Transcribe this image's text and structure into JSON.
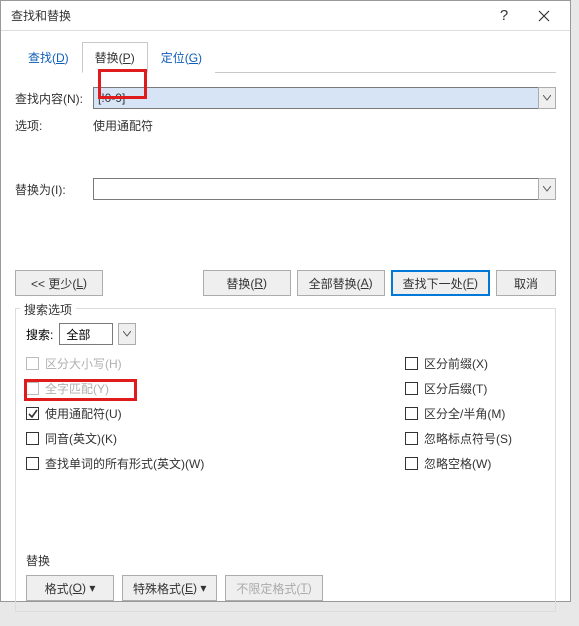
{
  "titlebar": {
    "title": "查找和替换"
  },
  "tabs": {
    "find": {
      "label": "查找(",
      "key": "D",
      "suffix": ")"
    },
    "replace": {
      "label": "替换(",
      "key": "P",
      "suffix": ")"
    },
    "goto": {
      "label": "定位(",
      "key": "G",
      "suffix": ")"
    }
  },
  "form": {
    "find_label_pre": "查找内容(",
    "find_key": "N",
    "find_label_suf": "):",
    "find_value": "[!0-9]",
    "options_label": "选项:",
    "options_value": "使用通配符",
    "replace_label_pre": "替换为(",
    "replace_key": "I",
    "replace_label_suf": "):",
    "replace_value": ""
  },
  "buttons": {
    "less_pre": "<< 更少(",
    "less_key": "L",
    "less_suf": ")",
    "replace_pre": "替换(",
    "replace_key": "R",
    "replace_suf": ")",
    "replace_all_pre": "全部替换(",
    "replace_all_key": "A",
    "replace_all_suf": ")",
    "find_next_pre": "查找下一处(",
    "find_next_key": "F",
    "find_next_suf": ")",
    "cancel": "取消"
  },
  "search_options": {
    "legend": "搜索选项",
    "search_label": "搜索:",
    "search_value": "全部",
    "cb": {
      "match_case_pre": "区分大小写(",
      "match_case_key": "H",
      "match_case_suf": ")",
      "whole_word_pre": "全字匹配(",
      "whole_word_key": "Y",
      "whole_word_suf": ")",
      "wildcards_pre": "使用通配符(",
      "wildcards_key": "U",
      "wildcards_suf": ")",
      "sounds_like_pre": "同音(英文)(",
      "sounds_like_key": "K",
      "sounds_like_suf": ")",
      "all_forms_pre": "查找单词的所有形式(英文)(",
      "all_forms_key": "W",
      "all_forms_suf": ")",
      "prefix_pre": "区分前缀(",
      "prefix_key": "X",
      "prefix_suf": ")",
      "suffix_pre": "区分后缀(",
      "suffix_key": "T",
      "suffix_suf": ")",
      "fullhalf_pre": "区分全/半角(",
      "fullhalf_key": "M",
      "fullhalf_suf": ")",
      "ignore_punct_pre": "忽略标点符号(",
      "ignore_punct_key": "S",
      "ignore_punct_suf": ")",
      "ignore_space_pre": "忽略空格(",
      "ignore_space_key": "W",
      "ignore_space_suf": ")"
    }
  },
  "replace_section": {
    "label": "替换",
    "format_pre": "格式(",
    "format_key": "O",
    "format_suf": ") ▾",
    "special_pre": "特殊格式(",
    "special_key": "E",
    "special_suf": ") ▾",
    "noformat_pre": "不限定格式(",
    "noformat_key": "T",
    "noformat_suf": ")"
  }
}
